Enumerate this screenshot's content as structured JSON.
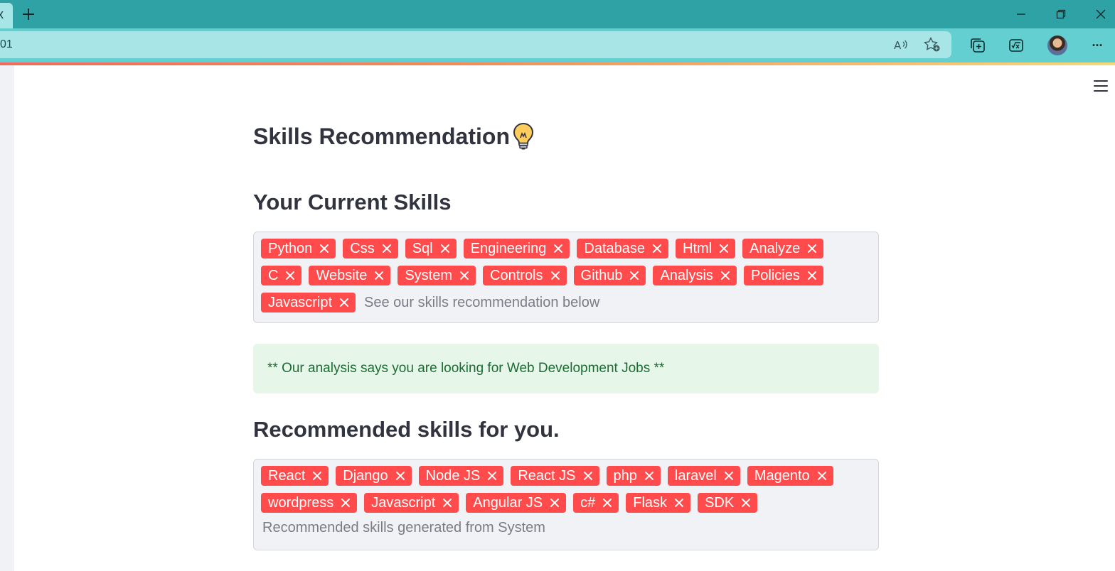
{
  "browser": {
    "url_fragment": "01",
    "tab_stub_glyph": "x",
    "new_tab_label": "+",
    "more_label": "···"
  },
  "page": {
    "title": "Skills Recommendation",
    "title_emoji": "lightbulb-icon",
    "current_skills": {
      "heading": "Your Current Skills",
      "tags": [
        "Python",
        "Css",
        "Sql",
        "Engineering",
        "Database",
        "Html",
        "Analyze",
        "C",
        "Website",
        "System",
        "Controls",
        "Github",
        "Analysis",
        "Policies",
        "Javascript"
      ],
      "placeholder": "See our skills recommendation below"
    },
    "analysis_message": "** Our analysis says you are looking for Web Development Jobs **",
    "recommended_skills": {
      "heading": "Recommended skills for you.",
      "tags": [
        "React",
        "Django",
        "Node JS",
        "React JS",
        "php",
        "laravel",
        "Magento",
        "wordpress",
        "Javascript",
        "Angular JS",
        "c#",
        "Flask",
        "SDK"
      ],
      "placeholder": "Recommended skills generated from System"
    }
  },
  "colors": {
    "accent_tag": "#ff4b4b",
    "tabbar": "#2fa2a6",
    "addressbar": "#63cfd1",
    "success_bg": "#e6f7ea",
    "success_text": "#1c6b33"
  }
}
